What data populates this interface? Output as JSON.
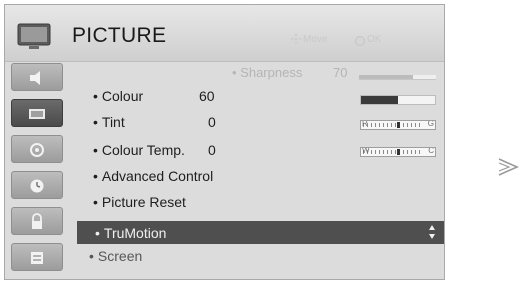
{
  "header": {
    "title": "PICTURE",
    "hint_move": "Move",
    "hint_ok": "OK"
  },
  "sidebar": {
    "items": [
      {
        "icon": "speaker-icon",
        "active": false
      },
      {
        "icon": "picture-icon",
        "active": true
      },
      {
        "icon": "settings-icon",
        "active": false
      },
      {
        "icon": "clock-icon",
        "active": false
      },
      {
        "icon": "lock-icon",
        "active": false
      },
      {
        "icon": "option-icon",
        "active": false
      }
    ]
  },
  "menu": {
    "sharpness": {
      "label": "• Sharpness",
      "value": "70",
      "level": 0.7
    },
    "items": [
      {
        "label": "Colour",
        "value": "60"
      },
      {
        "label": "Tint",
        "value": "0"
      },
      {
        "label": "Colour Temp.",
        "value": "0"
      },
      {
        "label": "Advanced Control",
        "value": ""
      },
      {
        "label": "Picture Reset",
        "value": ""
      }
    ],
    "colour_level": 0.5,
    "tint_labels": {
      "left": "R",
      "right": "G"
    },
    "temp_labels": {
      "left": "W",
      "right": "C"
    },
    "selected": "TruMotion",
    "next_item": "Screen"
  },
  "colors": {
    "panel": "#dcdcdc",
    "highlight": "#4f4f4f",
    "text": "#1e1e1e"
  }
}
